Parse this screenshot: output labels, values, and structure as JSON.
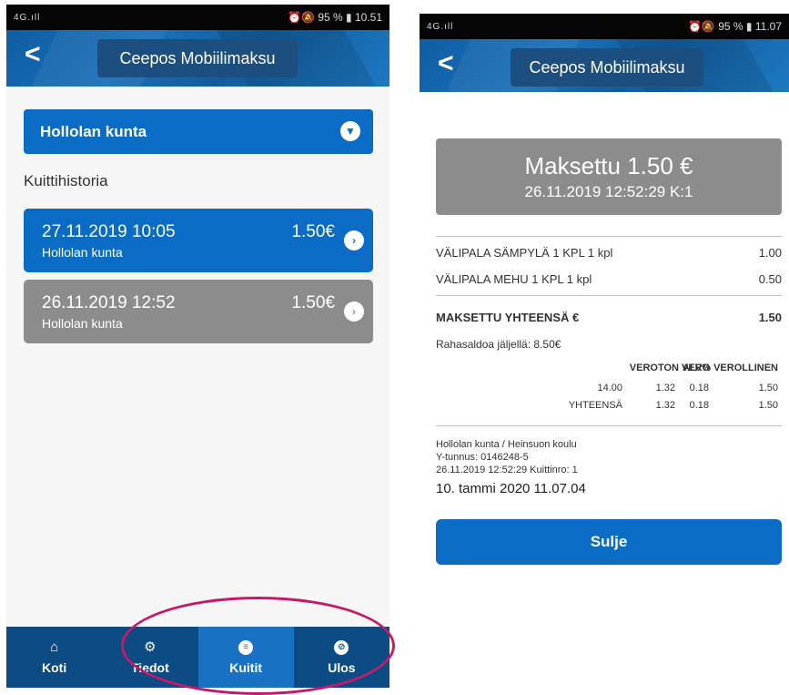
{
  "left": {
    "status": {
      "signal": "4G.ıll",
      "icons": "⏰🔕",
      "battery": "95 %",
      "time": "10.51"
    },
    "header": {
      "back": "<",
      "title": "Ceepos Mobiilimaksu"
    },
    "dropdown_label": "Hollolan kunta",
    "section_title": "Kuittihistoria",
    "receipts": [
      {
        "date": "27.11.2019 10:05",
        "subtitle": "Hollolan kunta",
        "amount": "1.50€",
        "color": "#0a6cc4"
      },
      {
        "date": "26.11.2019 12:52",
        "subtitle": "Hollolan kunta",
        "amount": "1.50€",
        "color": "#8c8c8c"
      }
    ],
    "nav": [
      {
        "label": "Koti",
        "icon": "home-icon"
      },
      {
        "label": "Tiedot",
        "icon": "gear-icon"
      },
      {
        "label": "Kuitit",
        "icon": "list-icon"
      },
      {
        "label": "Ulos",
        "icon": "logout-icon"
      }
    ]
  },
  "right": {
    "status": {
      "signal": "4G.ıll",
      "icons": "⏰🔕",
      "battery": "95 %",
      "time": "11.07"
    },
    "header": {
      "back": "<",
      "title": "Ceepos Mobiilimaksu"
    },
    "paid_title": "Maksettu 1.50 €",
    "paid_date": "26.11.2019 12:52:29 K:1",
    "items": [
      {
        "name": "VÄLIPALA SÄMPYLÄ 1 KPL 1 kpl",
        "price": "1.00"
      },
      {
        "name": "VÄLIPALA MEHU 1 KPL 1 kpl",
        "price": "0.50"
      }
    ],
    "total_label": "MAKSETTU YHTEENSÄ €",
    "total_value": "1.50",
    "balance": "Rahasaldoa jäljellä: 8.50€",
    "vat": {
      "headers": [
        "ALV%",
        "VEROTON",
        "VERO",
        "VEROLLINEN"
      ],
      "row1": [
        "14.00",
        "1.32",
        "0.18",
        "1.50"
      ],
      "row2": [
        "YHTEENSÄ",
        "1.32",
        "0.18",
        "1.50"
      ]
    },
    "footer": [
      "Hollolan kunta / Heinsuon koulu",
      "Y-tunnus: 0146248-5",
      "26.11.2019 12:52:29 Kuittinro: 1"
    ],
    "timestamp": "10. tammi 2020 11.07.04",
    "close_label": "Sulje"
  },
  "colors": {
    "primary": "#0a6cc4",
    "nav_bg": "#0d4b84",
    "nav_active": "#1a72c4",
    "highlight_ellipse": "#c71969",
    "grey_card": "#8c8c8c"
  }
}
